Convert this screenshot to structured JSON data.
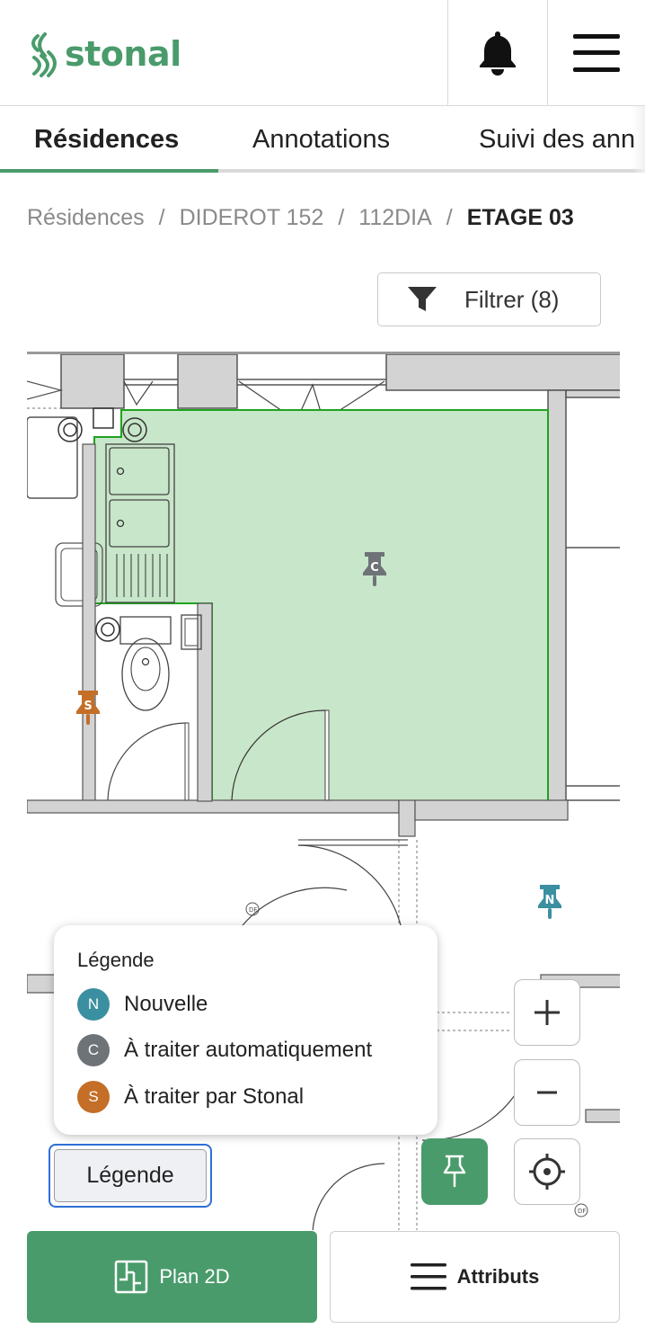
{
  "header": {
    "brand": "stonal",
    "bell_icon": "bell-icon",
    "menu_icon": "hamburger-menu-icon",
    "brand_color": "#4a9b6b"
  },
  "tabs": [
    {
      "label": "Résidences",
      "active": true
    },
    {
      "label": "Annotations",
      "active": false
    },
    {
      "label": "Suivi des ann",
      "active": false
    }
  ],
  "breadcrumb": {
    "items": [
      "Résidences",
      "DIDEROT 152",
      "112DIA"
    ],
    "current": "ETAGE 03",
    "separator": "/"
  },
  "filter": {
    "label": "Filtrer (8)",
    "icon": "funnel-icon"
  },
  "plan": {
    "room_highlight_color": "#c8e6c9",
    "room_outline_color": "#1fa31f",
    "door_label": "DF",
    "pins": [
      {
        "status": "C",
        "color": "#6e7378"
      },
      {
        "status": "S",
        "color": "#c46e27"
      },
      {
        "status": "N",
        "color": "#3a8fa0"
      }
    ]
  },
  "legend": {
    "title": "Légende",
    "items": [
      {
        "letter": "N",
        "label": "Nouvelle",
        "color": "#3a8fa0"
      },
      {
        "letter": "C",
        "label": "À traiter automatiquement",
        "color": "#6e7378"
      },
      {
        "letter": "S",
        "label": "À traiter par Stonal",
        "color": "#c46e27"
      }
    ],
    "toggle_label": "Légende"
  },
  "controls": {
    "zoom_in": "+",
    "zoom_out": "−"
  },
  "bottom_bar": {
    "plan2d_label": "Plan 2D",
    "attributs_label": "Attributs"
  }
}
